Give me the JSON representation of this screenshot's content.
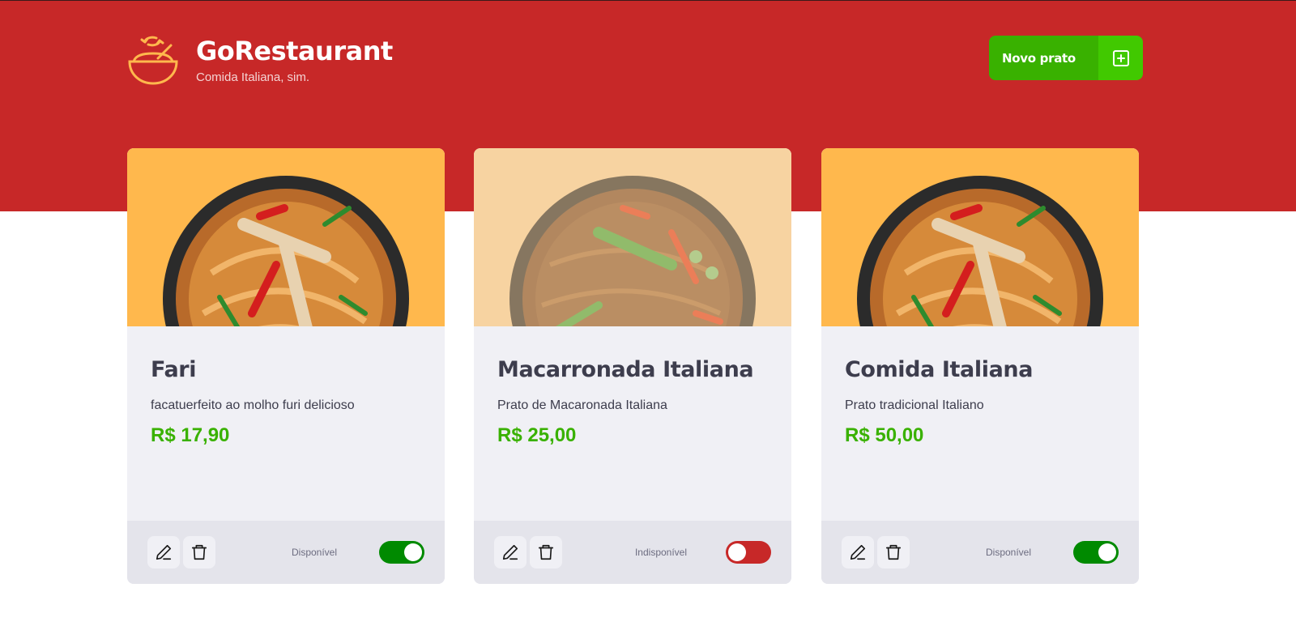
{
  "header": {
    "brand_title": "GoRestaurant",
    "brand_subtitle": "Comida Italiana, sim.",
    "new_dish_label": "Novo prato"
  },
  "colors": {
    "header_red": "#c72828",
    "brand_orange": "#ffb84d",
    "price_green": "#39b100",
    "toggle_on": "#008a00",
    "toggle_off": "#c72828"
  },
  "dishes": [
    {
      "name": "Fari",
      "description": "facatuerfeito ao molho furi delicioso",
      "price": "R$ 17,90",
      "available": true,
      "availability_label": "Disponível"
    },
    {
      "name": "Macarronada Italiana",
      "description": "Prato de Macaronada Italiana",
      "price": "R$ 25,00",
      "available": false,
      "availability_label": "Indisponível"
    },
    {
      "name": "Comida Italiana",
      "description": "Prato tradicional Italiano",
      "price": "R$ 50,00",
      "available": true,
      "availability_label": "Disponível"
    }
  ]
}
